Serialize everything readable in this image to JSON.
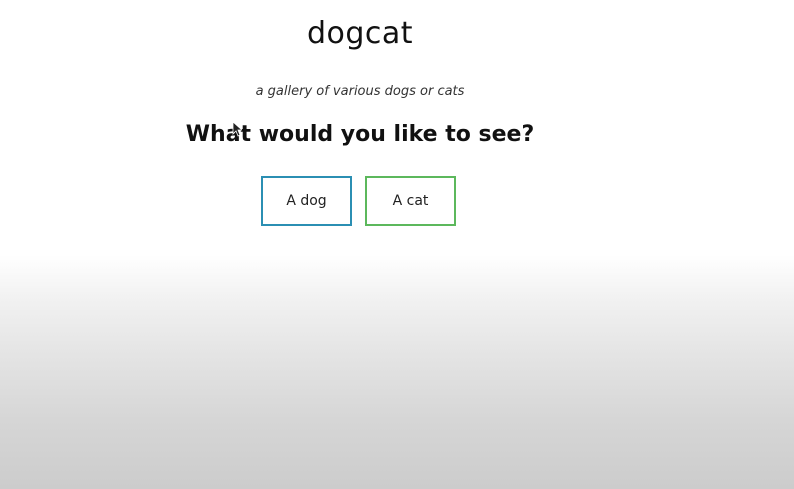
{
  "site": {
    "title": "dogcat",
    "tagline": "a gallery of various dogs or cats",
    "question": "What would you like to see?"
  },
  "choices": [
    {
      "label": "A dog",
      "accent": "#2b8fb3"
    },
    {
      "label": "A cat",
      "accent": "#5cb85c"
    }
  ],
  "icons": {
    "cursor": "mouse-pointer-icon"
  }
}
